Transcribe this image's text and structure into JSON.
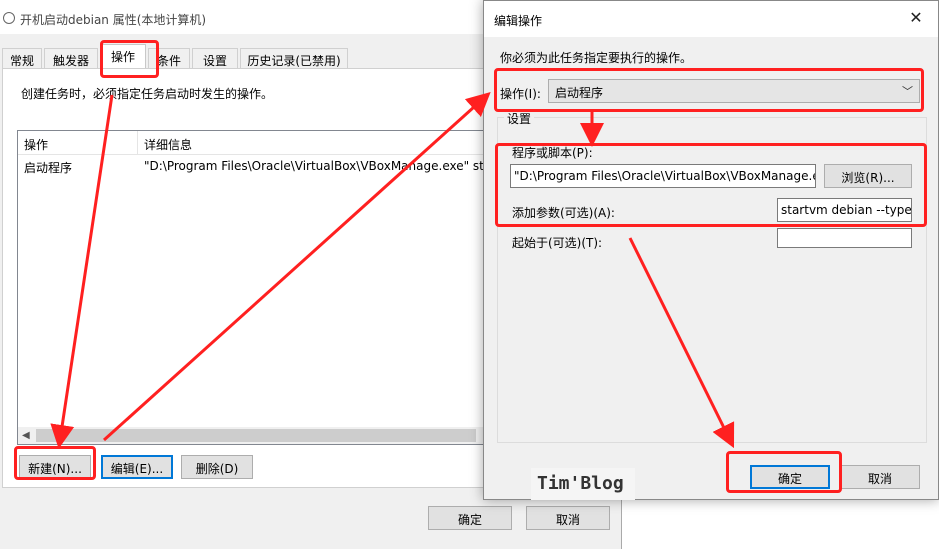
{
  "bg_window": {
    "title": "开机启动debian 属性(本地计算机)",
    "tabs": [
      {
        "label": "常规"
      },
      {
        "label": "触发器"
      },
      {
        "label": "操作"
      },
      {
        "label": "条件"
      },
      {
        "label": "设置"
      },
      {
        "label": "历史记录(已禁用)"
      }
    ],
    "description": "创建任务时，必须指定任务启动时发生的操作。",
    "columns": [
      "操作",
      "详细信息"
    ],
    "rows": [
      {
        "action": "启动程序",
        "details": "\"D:\\Program Files\\Oracle\\VirtualBox\\VBoxManage.exe\" startvm debian --type headless"
      }
    ],
    "buttons": {
      "new": "新建(N)...",
      "edit": "编辑(E)...",
      "delete": "删除(D)"
    },
    "ok": "确定",
    "cancel": "取消"
  },
  "dialog": {
    "title": "编辑操作",
    "close_glyph": "✕",
    "description": "你必须为此任务指定要执行的操作。",
    "action_label": "操作(I):",
    "action_value": "启动程序",
    "settings_group": "设置",
    "program_label": "程序或脚本(P):",
    "program_value": "\"D:\\Program Files\\Oracle\\VirtualBox\\VBoxManage.exe\"",
    "browse": "浏览(R)...",
    "args_label": "添加参数(可选)(A):",
    "args_value": "startvm debian --type",
    "start_in_label": "起始于(可选)(T):",
    "start_in_value": "",
    "ok": "确定",
    "cancel": "取消"
  },
  "watermark": "Tim'Blog",
  "colors": {
    "annotation": "#ff2020",
    "focus": "#0078d7"
  }
}
